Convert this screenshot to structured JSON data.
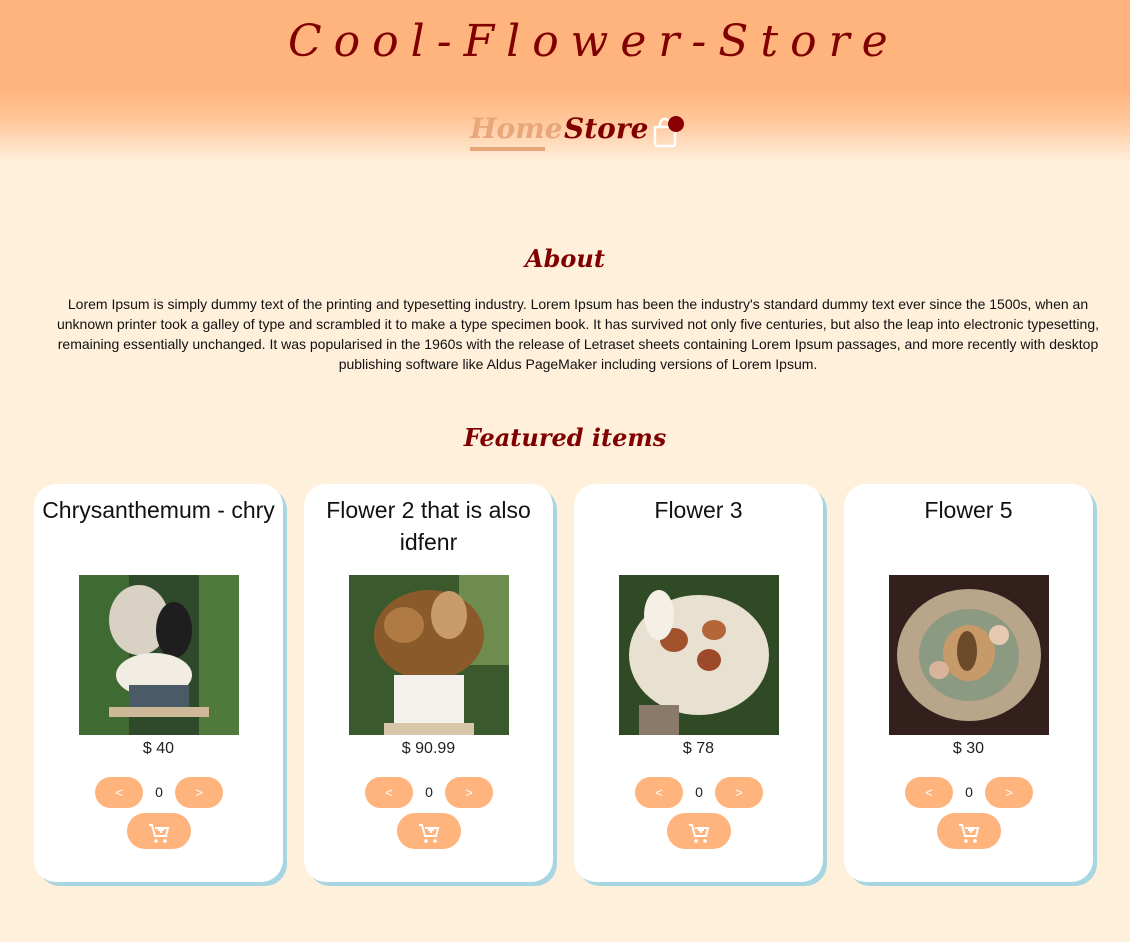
{
  "header": {
    "site_title": "Cool-Flower-Store",
    "nav": {
      "home": "Home",
      "store": "Store"
    },
    "cart_icon": "shopping-bag-icon",
    "colors": {
      "header_bg": "#FFB47E",
      "title_color": "#800000",
      "active_link": "#E8A77A",
      "badge": "#8B0000"
    }
  },
  "about": {
    "title": "About",
    "text": "Lorem Ipsum is simply dummy text of the printing and typesetting industry. Lorem Ipsum has been the industry's standard dummy text ever since the 1500s, when an unknown printer took a galley of type and scrambled it to make a type specimen book. It has survived not only five centuries, but also the leap into electronic typesetting, remaining essentially unchanged. It was popularised in the 1960s with the release of Letraset sheets containing Lorem Ipsum passages, and more recently with desktop publishing software like Aldus PageMaker including versions of Lorem Ipsum."
  },
  "featured": {
    "title": "Featured items",
    "items": [
      {
        "name": "Chrysanthemum - chry",
        "price": "$ 40",
        "quantity": "0",
        "prev_label": "<",
        "next_label": ">",
        "add_icon": "add-shopping-cart-icon"
      },
      {
        "name": "Flower 2 that is also idfenr",
        "price": "$ 90.99",
        "quantity": "0",
        "prev_label": "<",
        "next_label": ">",
        "add_icon": "add-shopping-cart-icon"
      },
      {
        "name": "Flower 3",
        "price": "$ 78",
        "quantity": "0",
        "prev_label": "<",
        "next_label": ">",
        "add_icon": "add-shopping-cart-icon"
      },
      {
        "name": "Flower 5",
        "price": "$ 30",
        "quantity": "0",
        "prev_label": "<",
        "next_label": ">",
        "add_icon": "add-shopping-cart-icon"
      }
    ]
  },
  "colors": {
    "page_bg": "#FFF0DC",
    "button_bg": "#FFB47E",
    "card_shadow": "#A8D5E2"
  }
}
